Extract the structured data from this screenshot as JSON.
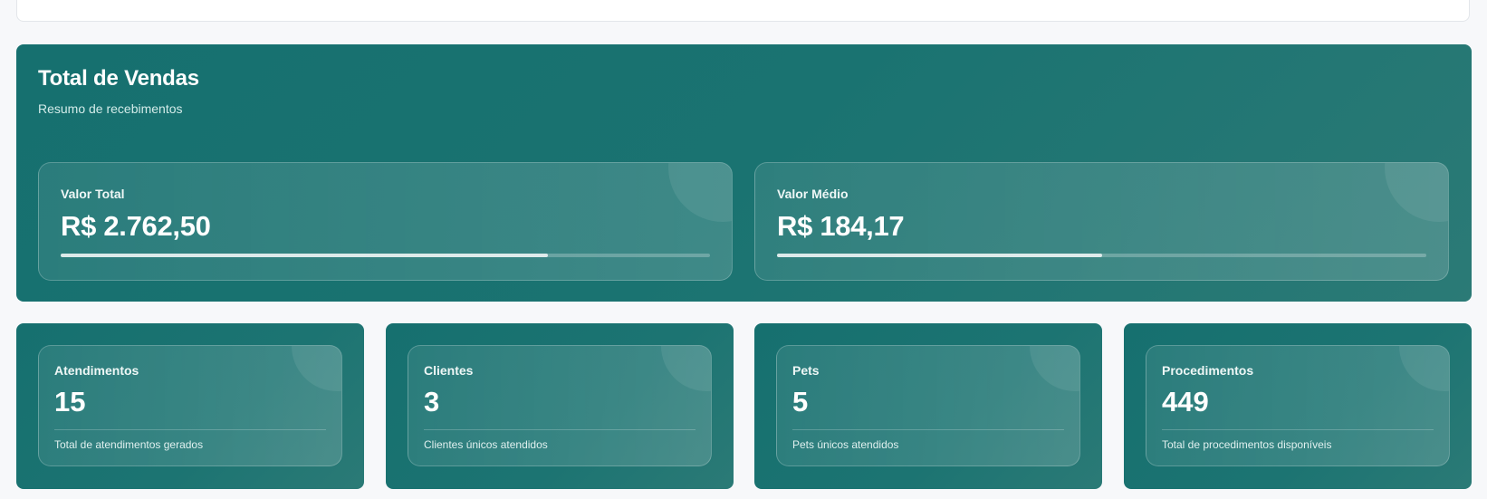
{
  "sales": {
    "title": "Total de Vendas",
    "subtitle": "Resumo de recebimentos",
    "metrics": [
      {
        "label": "Valor Total",
        "value": "R$ 2.762,50",
        "progress": 0.75
      },
      {
        "label": "Valor Médio",
        "value": "R$ 184,17",
        "progress": 0.5
      }
    ]
  },
  "stats": [
    {
      "label": "Atendimentos",
      "value": "15",
      "description": "Total de atendimentos gerados"
    },
    {
      "label": "Clientes",
      "value": "3",
      "description": "Clientes únicos atendidos"
    },
    {
      "label": "Pets",
      "value": "5",
      "description": "Pets únicos atendidos"
    },
    {
      "label": "Procedimentos",
      "value": "449",
      "description": "Total de procedimentos disponíveis"
    }
  ],
  "colors": {
    "card_teal": "#16706f",
    "card_teal_light": "#2b7a76",
    "page_background": "#f7f8fa"
  }
}
